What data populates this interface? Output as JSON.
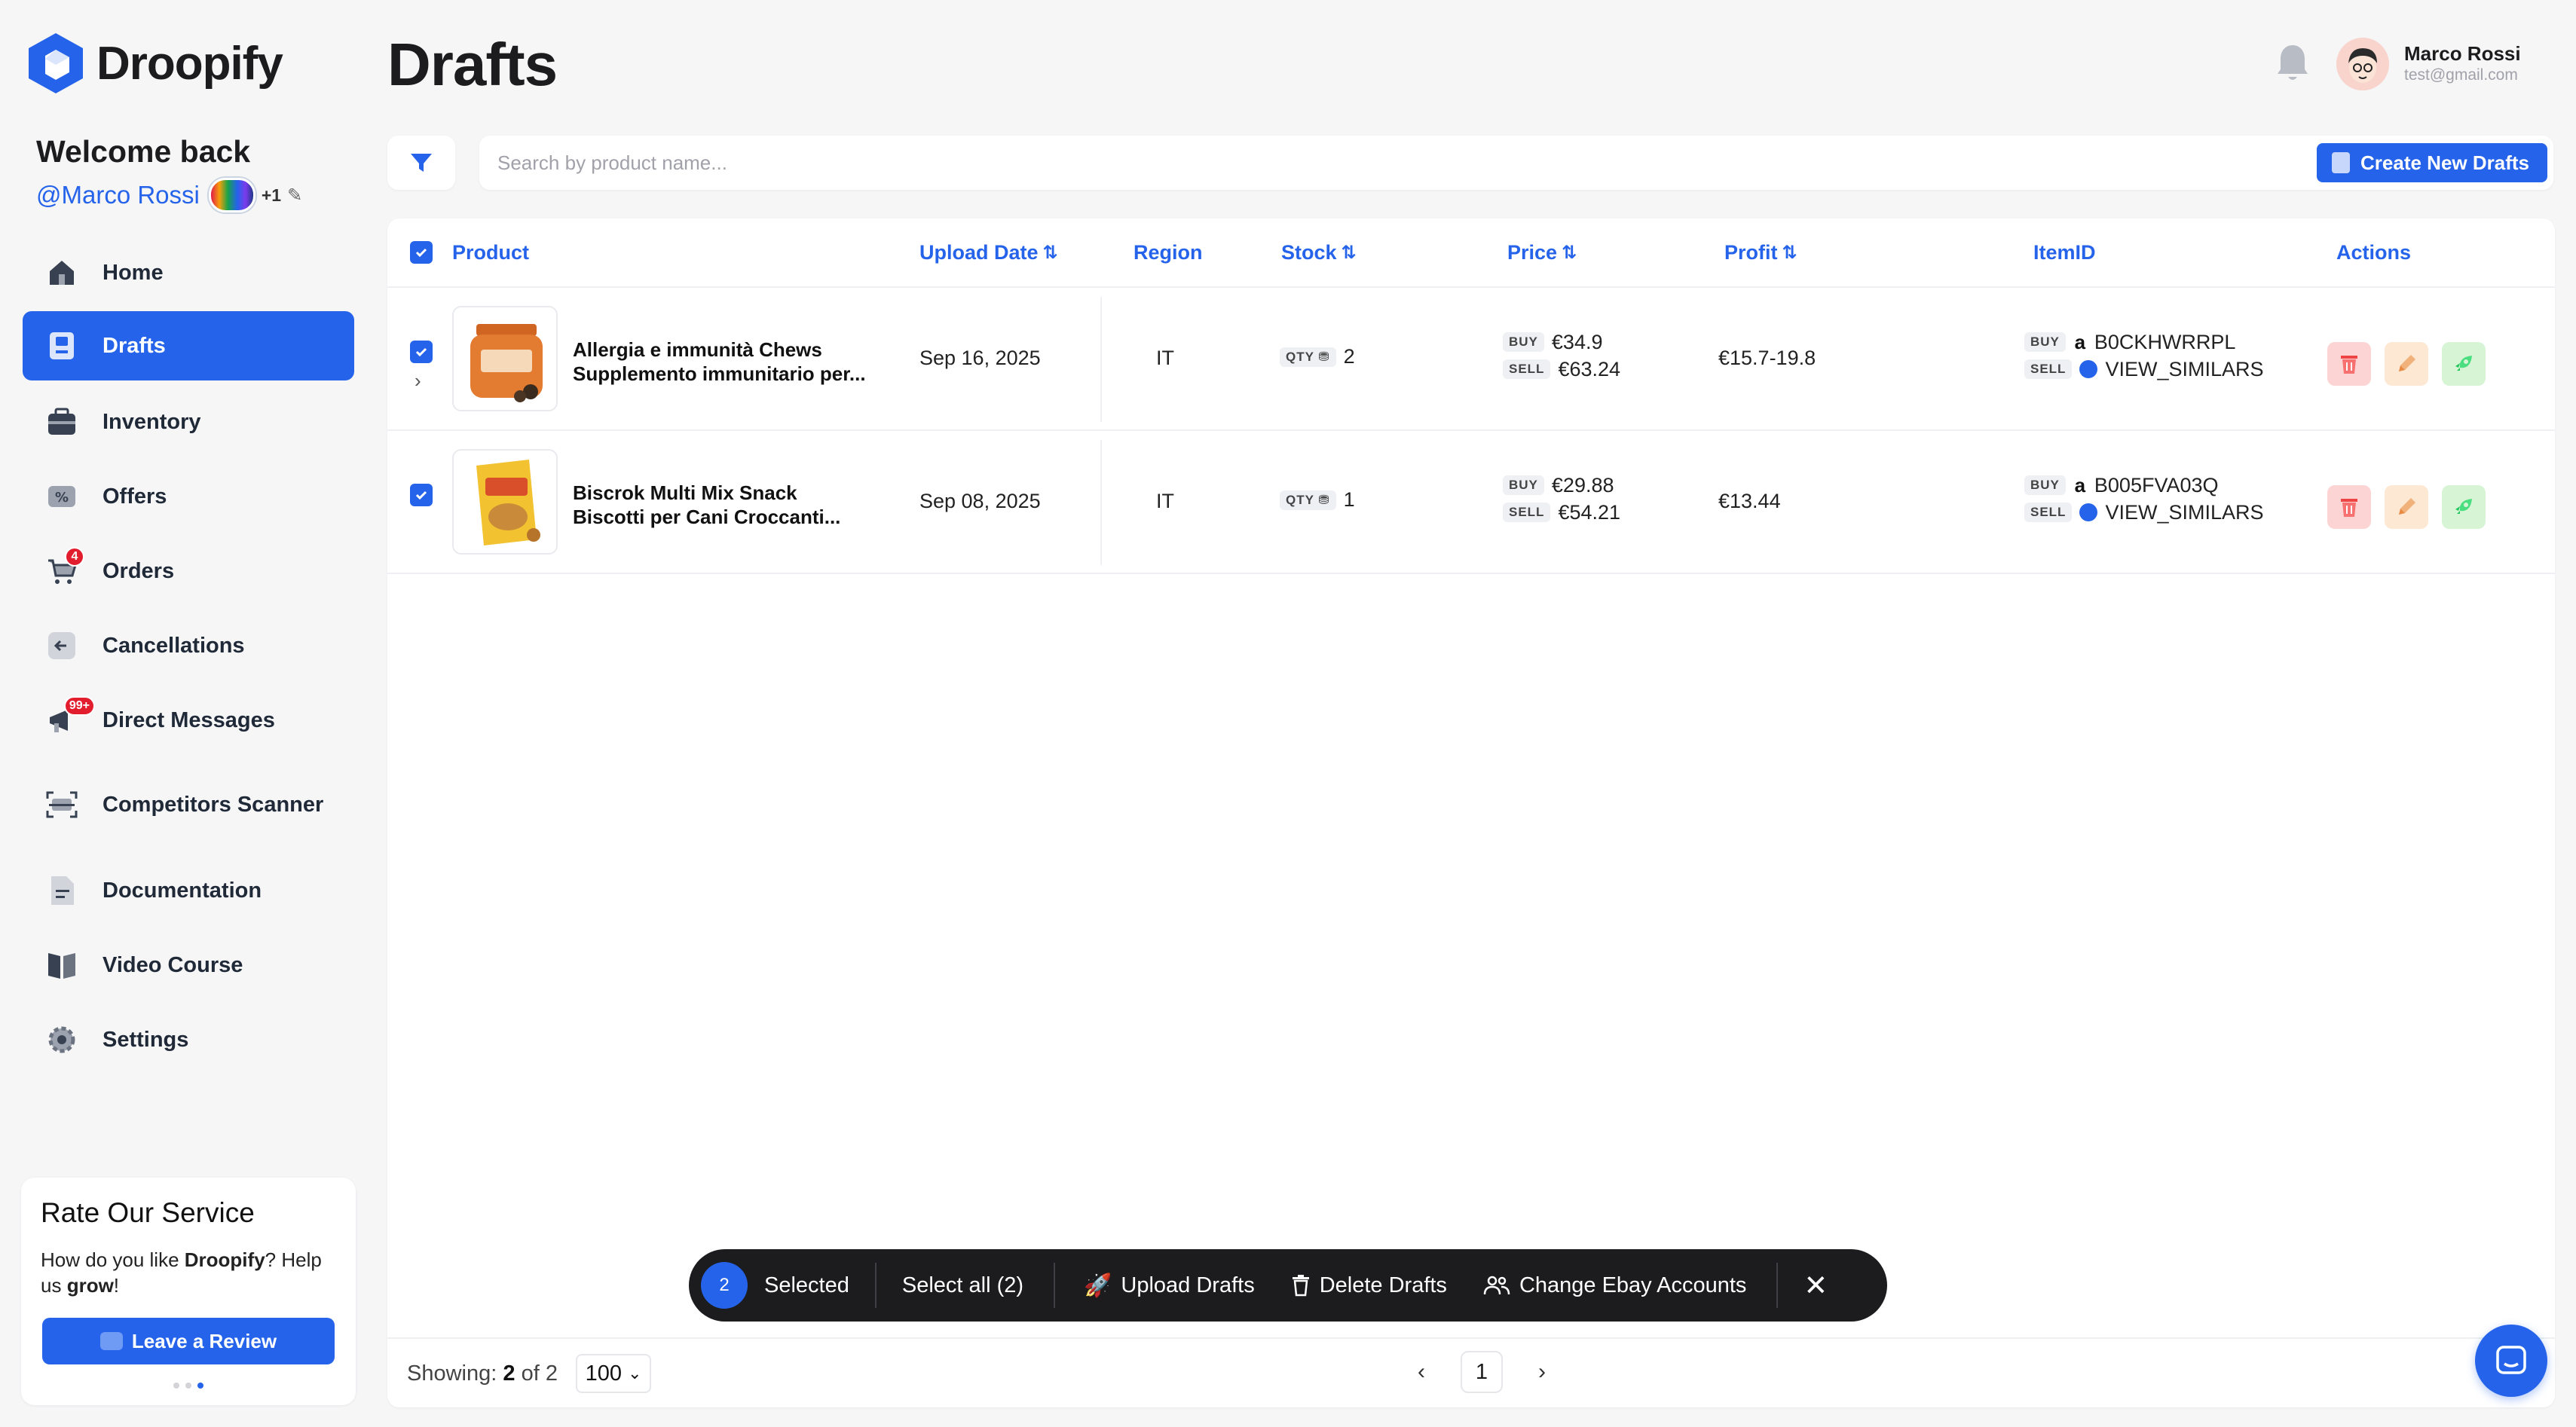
{
  "brand": {
    "name": "Droopify",
    "accent": "#2563eb"
  },
  "sidebar": {
    "welcome": "Welcome back",
    "handle": "@Marco Rossi",
    "extra_accounts": "+1",
    "items": [
      {
        "label": "Home",
        "icon": "home-icon"
      },
      {
        "label": "Drafts",
        "icon": "drafts-icon",
        "active": true
      },
      {
        "label": "Inventory",
        "icon": "inventory-icon"
      },
      {
        "label": "Offers",
        "icon": "offers-icon"
      },
      {
        "label": "Orders",
        "icon": "cart-icon",
        "badge": "4"
      },
      {
        "label": "Cancellations",
        "icon": "cancel-icon"
      },
      {
        "label": "Direct Messages",
        "icon": "megaphone-icon",
        "badge": "99+"
      },
      {
        "label": "Competitors Scanner",
        "icon": "scanner-icon"
      },
      {
        "label": "Documentation",
        "icon": "document-icon"
      },
      {
        "label": "Video Course",
        "icon": "book-icon"
      },
      {
        "label": "Settings",
        "icon": "gear-icon"
      }
    ],
    "rate": {
      "title": "Rate Our Service",
      "text_pre": "How do you like ",
      "text_brand": "Droopify",
      "text_mid": "? Help us ",
      "text_bold": "grow",
      "text_end": "!",
      "button": "Leave a Review"
    }
  },
  "header": {
    "title": "Drafts",
    "user_name": "Marco Rossi",
    "user_email": "test@gmail.com"
  },
  "toolbar": {
    "search_placeholder": "Search by product name...",
    "create_label": "Create New Drafts"
  },
  "table": {
    "columns": {
      "product": "Product",
      "upload_date": "Upload Date",
      "region": "Region",
      "stock": "Stock",
      "price": "Price",
      "profit": "Profit",
      "item_id": "ItemID",
      "actions": "Actions"
    },
    "qty_tag": "QTY",
    "buy_tag": "BUY",
    "sell_tag": "SELL",
    "rows": [
      {
        "name_line1": "Allergia e immunità Chews",
        "name_line2": "Supplemento immunitario per...",
        "date": "Sep 16, 2025",
        "region": "IT",
        "qty": "2",
        "buy": "€34.9",
        "sell": "€63.24",
        "profit": "€15.7-19.8",
        "buy_id": "B0CKHWRRPL",
        "sell_id": "VIEW_SIMILARS"
      },
      {
        "name_line1": "Biscrok Multi Mix Snack",
        "name_line2": "Biscotti per Cani Croccanti...",
        "date": "Sep 08, 2025",
        "region": "IT",
        "qty": "1",
        "buy": "€29.88",
        "sell": "€54.21",
        "profit": "€13.44",
        "buy_id": "B005FVA03Q",
        "sell_id": "VIEW_SIMILARS"
      }
    ]
  },
  "selection_bar": {
    "count": "2",
    "selected": "Selected",
    "select_all": "Select all (2)",
    "upload": "Upload Drafts",
    "delete": "Delete Drafts",
    "change": "Change Ebay Accounts"
  },
  "footer": {
    "showing_label": "Showing:",
    "showing_count": "2",
    "showing_of": "of 2",
    "per_page": "100",
    "page": "1"
  }
}
